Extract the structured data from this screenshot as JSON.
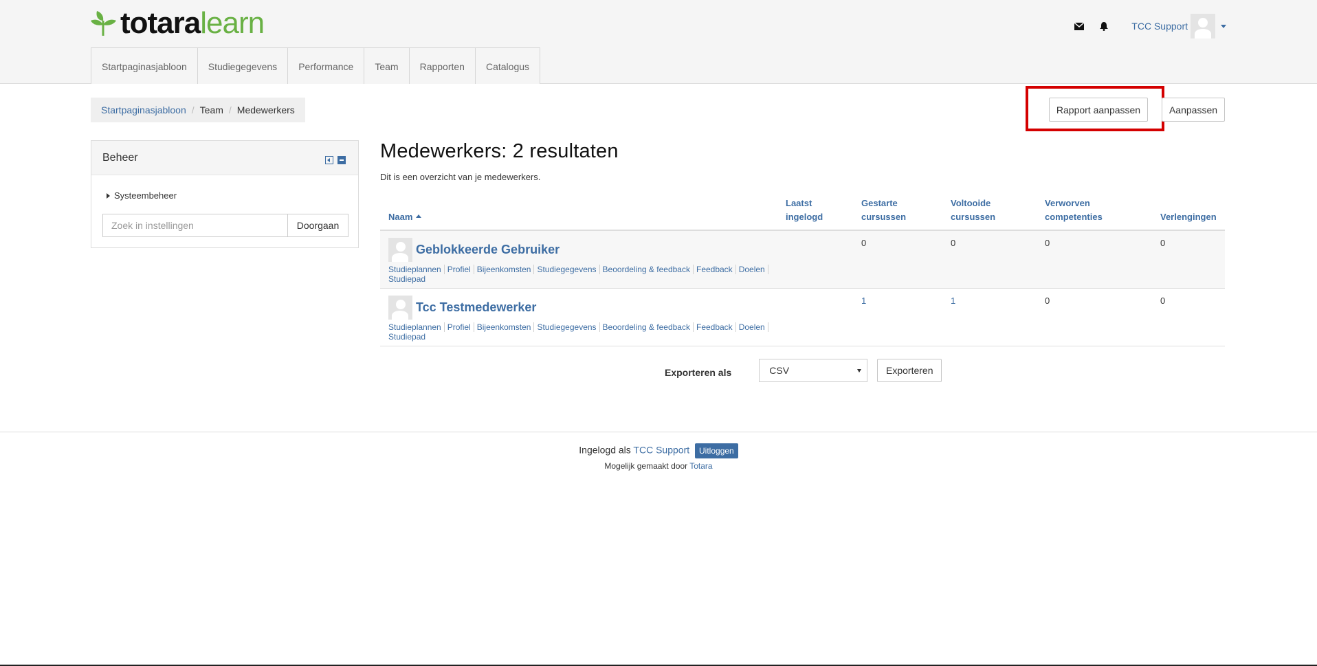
{
  "brand": {
    "bold": "totara",
    "light": "learn"
  },
  "header": {
    "user_name": "TCC Support",
    "icons": [
      "envelope-icon",
      "bell-icon"
    ]
  },
  "nav": {
    "items": [
      {
        "label": "Startpaginasjabloon"
      },
      {
        "label": "Studiegegevens"
      },
      {
        "label": "Performance"
      },
      {
        "label": "Team"
      },
      {
        "label": "Rapporten"
      },
      {
        "label": "Catalogus"
      }
    ]
  },
  "breadcrumb": {
    "items": [
      "Startpaginasjabloon",
      "Team",
      "Medewerkers"
    ]
  },
  "actions": {
    "report_edit": "Rapport aanpassen",
    "customize": "Aanpassen"
  },
  "sidebar": {
    "title": "Beheer",
    "tree_item": "Systeembeheer",
    "search_placeholder": "Zoek in instellingen",
    "search_button": "Doorgaan"
  },
  "main": {
    "title": "Medewerkers: 2 resultaten",
    "description": "Dit is een overzicht van je medewerkers."
  },
  "table": {
    "columns": [
      {
        "line1": "Naam",
        "line2": ""
      },
      {
        "line1": "Laatst",
        "line2": "ingelogd"
      },
      {
        "line1": "Gestarte",
        "line2": "cursussen"
      },
      {
        "line1": "Voltooide",
        "line2": "cursussen"
      },
      {
        "line1": "Verworven",
        "line2": "competenties"
      },
      {
        "line1": "Verlengingen",
        "line2": ""
      }
    ],
    "rows": [
      {
        "name": "Geblokkeerde Gebruiker",
        "last_login": "",
        "started": "0",
        "completed": "0",
        "competencies": "0",
        "renewals": "0",
        "links": [
          "Studieplannen",
          "Profiel",
          "Bijeenkomsten",
          "Studiegegevens",
          "Beoordeling & feedback",
          "Feedback",
          "Doelen",
          "Studiepad"
        ]
      },
      {
        "name": "Tcc Testmedewerker",
        "last_login": "",
        "started": "1",
        "completed": "1",
        "competencies": "0",
        "renewals": "0",
        "links": [
          "Studieplannen",
          "Profiel",
          "Bijeenkomsten",
          "Studiegegevens",
          "Beoordeling & feedback",
          "Feedback",
          "Doelen",
          "Studiepad"
        ]
      }
    ]
  },
  "export": {
    "label": "Exporteren als",
    "format": "CSV",
    "button": "Exporteren"
  },
  "footer": {
    "logged_in_as": "Ingelogd als",
    "user_name": "TCC Support",
    "logout": "Uitloggen",
    "powered_by": "Mogelijk gemaakt door",
    "powered_link": "Totara"
  },
  "colors": {
    "link": "#3d6da3",
    "brand_green": "#69b144",
    "highlight": "#d40000"
  }
}
